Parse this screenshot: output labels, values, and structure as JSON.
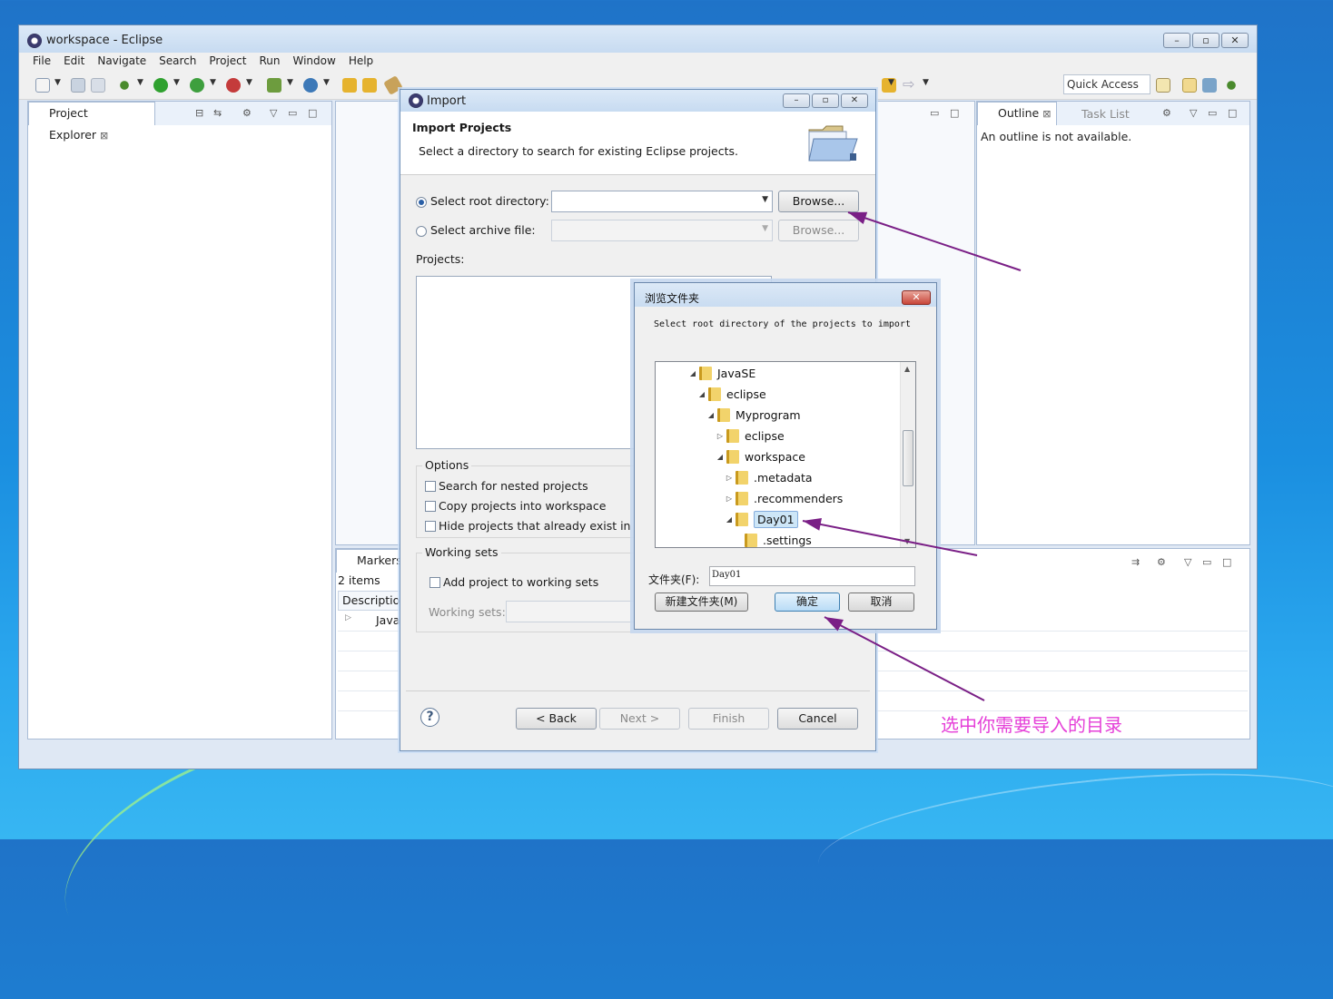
{
  "window": {
    "title": "workspace - Eclipse",
    "controls": [
      "–",
      "▫",
      "✕"
    ]
  },
  "menubar": [
    "File",
    "Edit",
    "Navigate",
    "Search",
    "Project",
    "Run",
    "Window",
    "Help"
  ],
  "toolbar": {
    "quick_access": "Quick Access"
  },
  "project_explorer": {
    "tab_label": "Project Explorer"
  },
  "outline": {
    "tab_label": "Outline",
    "task_list_label": "Task List",
    "message": "An outline is not available."
  },
  "markers": {
    "tab_label": "Markers",
    "count": "2 items",
    "column": "Description",
    "row": "Java"
  },
  "import_dialog": {
    "title": "Import",
    "header_title": "Import Projects",
    "header_subtitle": "Select a directory to search for existing Eclipse projects.",
    "root_dir_label": "Select root directory:",
    "archive_label": "Select archive file:",
    "browse_label": "Browse...",
    "projects_label": "Projects:",
    "options_title": "Options",
    "options": [
      "Search for nested projects",
      "Copy projects into workspace",
      "Hide projects that already exist in the"
    ],
    "working_sets_title": "Working sets",
    "add_working_set": "Add project to working sets",
    "working_sets_label": "Working sets:",
    "help": "?",
    "buttons": {
      "back": "< Back",
      "next": "Next >",
      "finish": "Finish",
      "cancel": "Cancel"
    }
  },
  "browse_dialog": {
    "title": "浏览文件夹",
    "close": "✕",
    "description": "Select root directory of the projects to import",
    "tree": [
      {
        "label": "JavaSE",
        "twisty": "◢",
        "state": "expanded"
      },
      {
        "label": "eclipse",
        "twisty": "◢",
        "state": "expanded"
      },
      {
        "label": "Myprogram",
        "twisty": "◢",
        "state": "expanded"
      },
      {
        "label": "eclipse",
        "twisty": "▷",
        "state": "collapsed"
      },
      {
        "label": "workspace",
        "twisty": "◢",
        "state": "expanded"
      },
      {
        "label": ".metadata",
        "twisty": "▷",
        "state": "collapsed"
      },
      {
        "label": ".recommenders",
        "twisty": "▷",
        "state": "collapsed"
      },
      {
        "label": "Day01",
        "twisty": "◢",
        "state": "selected"
      },
      {
        "label": ".settings",
        "twisty": "",
        "state": "leaf"
      }
    ],
    "folder_label": "文件夹(F):",
    "folder_value": "Day01",
    "new_folder": "新建文件夹(M)",
    "ok": "确定",
    "cancel": "取消"
  },
  "annotation": {
    "text": "选中你需要导入的目录",
    "color": "#e53fd8",
    "arrow_color": "#7a1f86"
  }
}
